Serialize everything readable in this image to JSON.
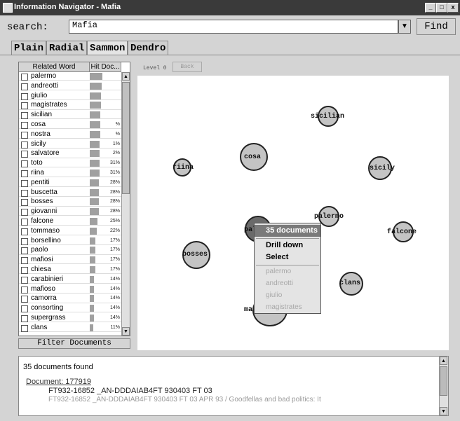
{
  "window": {
    "title": "Information Navigator - Mafia",
    "controls": [
      "_",
      "□",
      "x"
    ]
  },
  "search": {
    "label": "search:",
    "value": "Mafia",
    "find_label": "Find"
  },
  "tabs": [
    "Plain",
    "Radial",
    "Sammon",
    "Dendro"
  ],
  "table": {
    "headers": [
      "Related Word",
      "Hit Doc..."
    ],
    "rows": [
      {
        "word": "palermo",
        "pct": "",
        "fill": 0.4
      },
      {
        "word": "andreotti",
        "pct": "",
        "fill": 0.38
      },
      {
        "word": "giulio",
        "pct": "",
        "fill": 0.36
      },
      {
        "word": "magistrates",
        "pct": "",
        "fill": 0.35
      },
      {
        "word": "sicilian",
        "pct": "",
        "fill": 0.34
      },
      {
        "word": "cosa",
        "pct": "%",
        "fill": 0.33
      },
      {
        "word": "nostra",
        "pct": "%",
        "fill": 0.33
      },
      {
        "word": "sicily",
        "pct": "1%",
        "fill": 0.32
      },
      {
        "word": "salvatore",
        "pct": "2%",
        "fill": 0.31
      },
      {
        "word": "toto",
        "pct": "31%",
        "fill": 0.31
      },
      {
        "word": "riina",
        "pct": "31%",
        "fill": 0.31
      },
      {
        "word": "pentiti",
        "pct": "28%",
        "fill": 0.28
      },
      {
        "word": "buscetta",
        "pct": "28%",
        "fill": 0.28
      },
      {
        "word": "bosses",
        "pct": "28%",
        "fill": 0.28
      },
      {
        "word": "giovanni",
        "pct": "28%",
        "fill": 0.28
      },
      {
        "word": "falcone",
        "pct": "25%",
        "fill": 0.25
      },
      {
        "word": "tommaso",
        "pct": "22%",
        "fill": 0.22
      },
      {
        "word": "borsellino",
        "pct": "17%",
        "fill": 0.17
      },
      {
        "word": "paolo",
        "pct": "17%",
        "fill": 0.17
      },
      {
        "word": "mafiosi",
        "pct": "17%",
        "fill": 0.17
      },
      {
        "word": "chiesa",
        "pct": "17%",
        "fill": 0.17
      },
      {
        "word": "carabinieri",
        "pct": "14%",
        "fill": 0.14
      },
      {
        "word": "mafioso",
        "pct": "14%",
        "fill": 0.14
      },
      {
        "word": "camorra",
        "pct": "14%",
        "fill": 0.14
      },
      {
        "word": "consorting",
        "pct": "14%",
        "fill": 0.14
      },
      {
        "word": "supergrass",
        "pct": "14%",
        "fill": 0.14
      },
      {
        "word": "clans",
        "pct": "11%",
        "fill": 0.11
      }
    ],
    "filter_label": "Filter Documents"
  },
  "map": {
    "level_label": "Level 0",
    "back_label": "Back",
    "nodes": [
      {
        "label": "sicilian"
      },
      {
        "label": "cosa"
      },
      {
        "label": "riina"
      },
      {
        "label": "sicily"
      },
      {
        "label": "palermo"
      },
      {
        "label": "falcone"
      },
      {
        "label": "bosses"
      },
      {
        "label": "pal"
      },
      {
        "label": "clans"
      },
      {
        "label": "ma"
      }
    ]
  },
  "context_menu": {
    "header": "35 documents",
    "actions": [
      "Drill down",
      "Select"
    ],
    "words": [
      "palermo",
      "andreotti",
      "giulio",
      "magistrates"
    ]
  },
  "results": {
    "count_text": "35 documents found",
    "doc_link": "Document: 177919",
    "line1": "FT932-16852 _AN-DDDAIAB4FT 930403 FT 03",
    "line2": "FT932-16852 _AN-DDDAIAB4FT 930403 FT 03 APR 93 / Goodfellas and bad politics: It"
  }
}
